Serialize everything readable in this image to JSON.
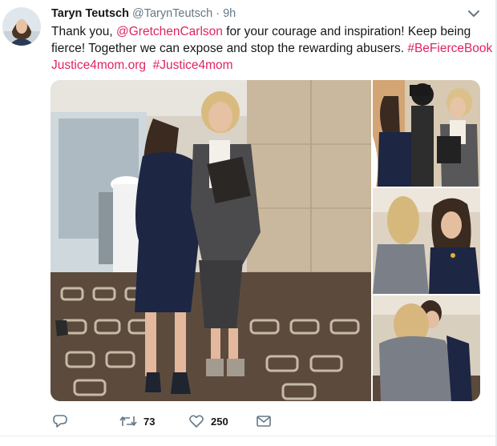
{
  "tweet": {
    "author_name": "Taryn Teutsch",
    "author_handle": "@TarynTeutsch",
    "separator": "·",
    "time": "9h",
    "text": {
      "line1_a": "Thank you, ",
      "line1_mention": "@GretchenCarlson",
      "line1_b": " for your courage and inspiration!  Keep being",
      "line2_a": "fierce! Together we can expose and stop the rewarding abusers. ",
      "line2_hashtag": "#BeFierceBook",
      "line3_link": "Justice4mom.org",
      "line3_hashtag": "#Justice4mom"
    },
    "media": {
      "count": 4,
      "photos": [
        "photo-main",
        "photo-top-right",
        "photo-middle-right",
        "photo-bottom-right"
      ]
    },
    "actions": {
      "reply_count": "",
      "retweet_count": "73",
      "like_count": "250"
    },
    "icons": {
      "caret": "chevron-down-icon",
      "reply": "reply-icon",
      "retweet": "retweet-icon",
      "like": "heart-icon",
      "dm": "envelope-icon"
    },
    "colors": {
      "link": "#e0245e",
      "muted": "#657786",
      "text": "#14171a",
      "icon": "#657786"
    }
  }
}
